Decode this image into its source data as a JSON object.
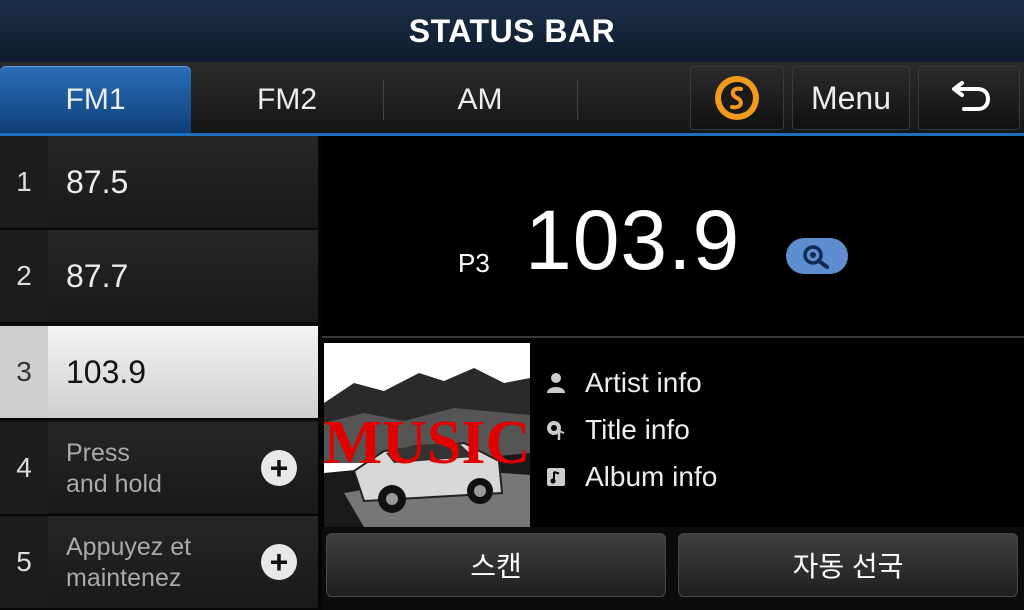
{
  "status_bar": {
    "title": "STATUS BAR"
  },
  "tabs": [
    {
      "label": "FM1",
      "active": true
    },
    {
      "label": "FM2",
      "active": false
    },
    {
      "label": "AM",
      "active": false
    }
  ],
  "toolbar": {
    "menu_label": "Menu",
    "soundhound_icon": "soundhound-icon",
    "back_icon": "back-arrow-icon"
  },
  "presets": [
    {
      "num": "1",
      "freq": "87.5"
    },
    {
      "num": "2",
      "freq": "87.7"
    },
    {
      "num": "3",
      "freq": "103.9",
      "selected": true
    },
    {
      "num": "4",
      "hint": [
        "Press",
        "and hold"
      ]
    },
    {
      "num": "5",
      "hint": [
        "Appuyez et",
        "maintenez"
      ]
    }
  ],
  "now_playing": {
    "preset_label": "P3",
    "frequency": "103.9"
  },
  "album_art": {
    "overlay_text": "MUSIC"
  },
  "info": [
    {
      "icon": "person-icon",
      "label": "Artist info"
    },
    {
      "icon": "music-note-search-icon",
      "label": "Title info"
    },
    {
      "icon": "album-icon",
      "label": "Album info"
    }
  ],
  "actions": {
    "scan_label": "스캔",
    "auto_tune_label": "자동 선국"
  },
  "colors": {
    "accent": "#1d6fc0",
    "search_pill": "#5e8ed0",
    "soundhound": "#f29a1e"
  }
}
